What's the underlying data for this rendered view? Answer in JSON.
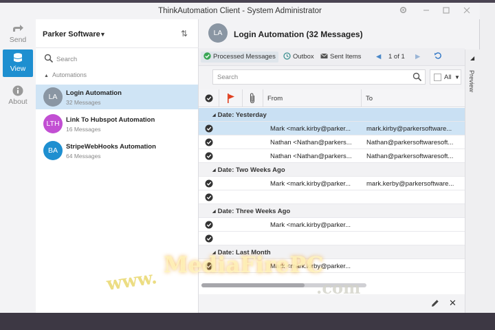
{
  "window": {
    "title": "ThinkAutomation Client - System Administrator",
    "controls": [
      "gear-icon",
      "minimize-icon",
      "maximize-icon",
      "close-icon"
    ]
  },
  "rail": {
    "items": [
      {
        "label": "Send",
        "icon": "send-arrow-icon",
        "active": false
      },
      {
        "label": "View",
        "icon": "database-icon",
        "active": true
      },
      {
        "label": "About",
        "icon": "info-icon",
        "active": false
      }
    ]
  },
  "list_pane": {
    "account": "Parker Software",
    "search_placeholder": "Search",
    "group_label": "Automations",
    "automations": [
      {
        "initials": "LA",
        "name": "Login Automation",
        "count": "32 Messages",
        "color": "#8a96a3",
        "selected": true
      },
      {
        "initials": "LTH",
        "name": "Link To Hubspot Automation",
        "count": "16 Messages",
        "color": "#c24fd3",
        "selected": false
      },
      {
        "initials": "BA",
        "name": "StripeWebHooks Automation",
        "count": "64 Messages",
        "color": "#1e8fd0",
        "selected": false
      }
    ]
  },
  "main": {
    "avatar": "LA",
    "title": "Login Automation (32 Messages)",
    "toolbar": {
      "processed": "Processed Messages",
      "outbox": "Outbox",
      "sent": "Sent Items",
      "pager": "1 of 1"
    },
    "search_placeholder": "Search",
    "filter_all": "All",
    "columns": {
      "from": "From",
      "to": "To"
    },
    "rows": [
      {
        "type": "group",
        "label": "Date: Yesterday"
      },
      {
        "type": "msg",
        "from": "Mark <mark.kirby@parker...",
        "to": "mark.kirby@parkersoftware...",
        "selected": true
      },
      {
        "type": "msg",
        "from": "Nathan <Nathan@parkers...",
        "to": "Nathan@parkersoftwaresoft..."
      },
      {
        "type": "msg",
        "from": "Nathan <Nathan@parkers...",
        "to": "Nathan@parkersoftwaresoft..."
      },
      {
        "type": "group",
        "label": "Date: Two Weeks Ago"
      },
      {
        "type": "msg",
        "from": "Mark <mark.kirby@parker...",
        "to": "mark.kerby@parkersoftware..."
      },
      {
        "type": "msg",
        "from": "",
        "to": ""
      },
      {
        "type": "group",
        "label": "Date: Three Weeks Ago"
      },
      {
        "type": "msg",
        "from": "Mark <mark.kirby@parker...",
        "to": ""
      },
      {
        "type": "msg",
        "from": "",
        "to": ""
      },
      {
        "type": "group",
        "label": "Date: Last Month"
      },
      {
        "type": "msg",
        "from": "Mark <mark.kirby@parker...",
        "to": ""
      }
    ]
  },
  "preview_label": "Preview",
  "watermark": {
    "left": "www.",
    "center": "MediaFirePC",
    "right": ".com"
  }
}
